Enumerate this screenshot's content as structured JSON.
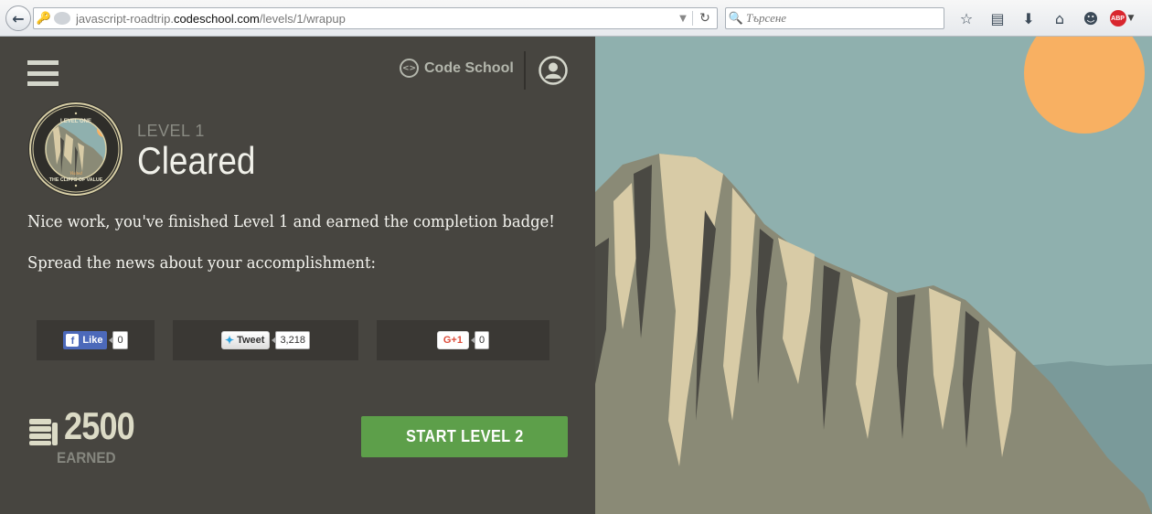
{
  "browser": {
    "url_prefix": "javascript-roadtrip.",
    "url_host": "codeschool.com",
    "url_path": "/levels/1/wrapup",
    "search_placeholder": "Търсене",
    "abp_label": "ABP"
  },
  "header": {
    "brand_name": "Code School",
    "brand_icon": "<>"
  },
  "badge": {
    "top_text": "LEVEL ONE",
    "script_text": "Visited",
    "bottom_text": "THE CLIFFS OF VALUE"
  },
  "level": {
    "label": "LEVEL 1",
    "status": "Cleared"
  },
  "messages": {
    "finished": "Nice work, you've finished Level 1 and earned the completion badge!",
    "spread": "Spread the news about your accomplishment:"
  },
  "share": {
    "facebook": {
      "label": "Like",
      "icon": "f",
      "count": "0"
    },
    "twitter": {
      "label": "Tweet",
      "count": "3,218"
    },
    "google": {
      "label": "G+1",
      "count": "0"
    }
  },
  "score": {
    "points": "2500",
    "label": "EARNED"
  },
  "actions": {
    "start_next": "START LEVEL 2"
  },
  "colors": {
    "panel_bg": "#474540",
    "start_button": "#5d9f4a",
    "sky": "#8fb0ae",
    "sun": "#f8b062",
    "cliff_light": "#d8cba6",
    "cliff_mid": "#8a8a76",
    "cliff_dark": "#4a4943"
  }
}
